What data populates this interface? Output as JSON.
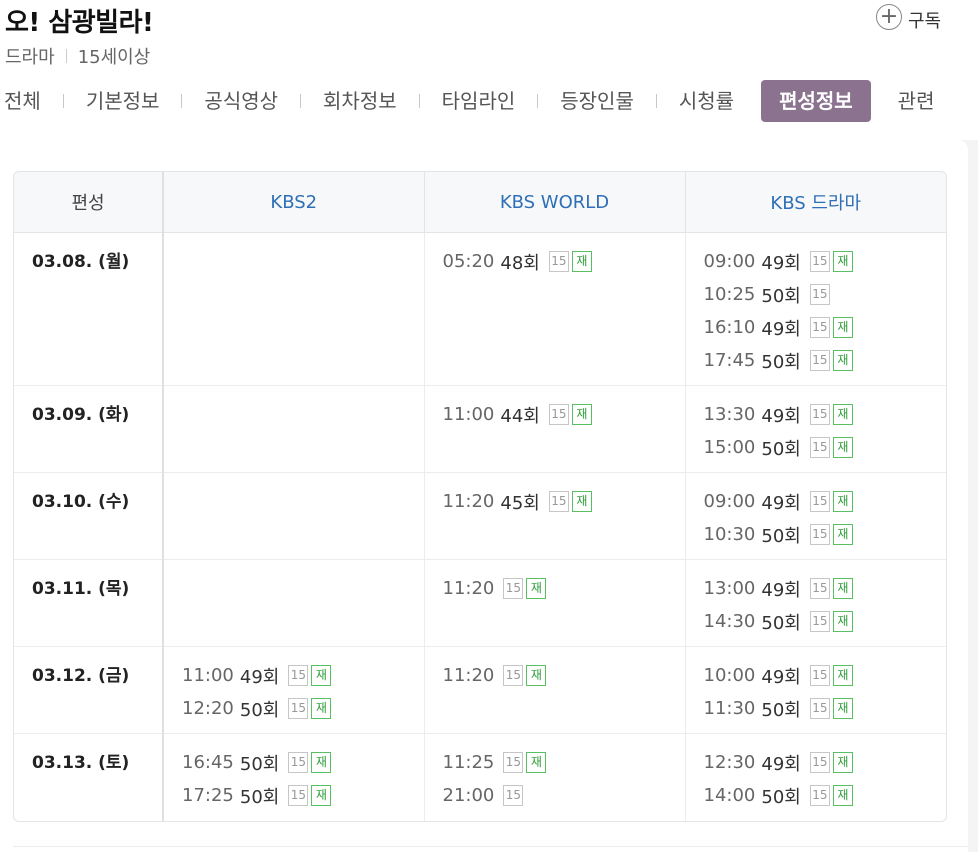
{
  "program": {
    "title": "오! 삼광빌라!",
    "genre": "드라마",
    "rating": "15세이상",
    "subscribe_label": "구독"
  },
  "nav": {
    "tabs": [
      "전체",
      "기본정보",
      "공식영상",
      "회차정보",
      "타임라인",
      "등장인물",
      "시청률"
    ],
    "active_tab": "편성정보",
    "trailing_tab": "관련"
  },
  "schedule": {
    "header": [
      "편성",
      "KBS2",
      "KBS WORLD",
      "KBS 드라마"
    ],
    "rating_badge": "15",
    "rerun_badge": "재",
    "rows": [
      {
        "date": "03.08. (월)",
        "channels": [
          [],
          [
            {
              "time": "05:20",
              "ep": "48회",
              "rerun": true
            }
          ],
          [
            {
              "time": "09:00",
              "ep": "49회",
              "rerun": true
            },
            {
              "time": "10:25",
              "ep": "50회",
              "rerun": false
            },
            {
              "time": "16:10",
              "ep": "49회",
              "rerun": true
            },
            {
              "time": "17:45",
              "ep": "50회",
              "rerun": true
            }
          ]
        ]
      },
      {
        "date": "03.09. (화)",
        "channels": [
          [],
          [
            {
              "time": "11:00",
              "ep": "44회",
              "rerun": true
            }
          ],
          [
            {
              "time": "13:30",
              "ep": "49회",
              "rerun": true
            },
            {
              "time": "15:00",
              "ep": "50회",
              "rerun": true
            }
          ]
        ]
      },
      {
        "date": "03.10. (수)",
        "channels": [
          [],
          [
            {
              "time": "11:20",
              "ep": "45회",
              "rerun": true
            }
          ],
          [
            {
              "time": "09:00",
              "ep": "49회",
              "rerun": true
            },
            {
              "time": "10:30",
              "ep": "50회",
              "rerun": true
            }
          ]
        ]
      },
      {
        "date": "03.11. (목)",
        "channels": [
          [],
          [
            {
              "time": "11:20",
              "ep": "",
              "rerun": true
            }
          ],
          [
            {
              "time": "13:00",
              "ep": "49회",
              "rerun": true
            },
            {
              "time": "14:30",
              "ep": "50회",
              "rerun": true
            }
          ]
        ]
      },
      {
        "date": "03.12. (금)",
        "channels": [
          [
            {
              "time": "11:00",
              "ep": "49회",
              "rerun": true
            },
            {
              "time": "12:20",
              "ep": "50회",
              "rerun": true
            }
          ],
          [
            {
              "time": "11:20",
              "ep": "",
              "rerun": true
            }
          ],
          [
            {
              "time": "10:00",
              "ep": "49회",
              "rerun": true
            },
            {
              "time": "11:30",
              "ep": "50회",
              "rerun": true
            }
          ]
        ]
      },
      {
        "date": "03.13. (토)",
        "channels": [
          [
            {
              "time": "16:45",
              "ep": "50회",
              "rerun": true
            },
            {
              "time": "17:25",
              "ep": "50회",
              "rerun": true
            }
          ],
          [
            {
              "time": "11:25",
              "ep": "",
              "rerun": true
            },
            {
              "time": "21:00",
              "ep": "",
              "rerun": false
            }
          ],
          [
            {
              "time": "12:30",
              "ep": "49회",
              "rerun": true
            },
            {
              "time": "14:00",
              "ep": "50회",
              "rerun": true
            }
          ]
        ]
      }
    ]
  },
  "colors": {
    "active_tab_bg": "#8b7390",
    "channel_header": "#2f6fb5",
    "rerun_badge": "#2e9e3a"
  }
}
